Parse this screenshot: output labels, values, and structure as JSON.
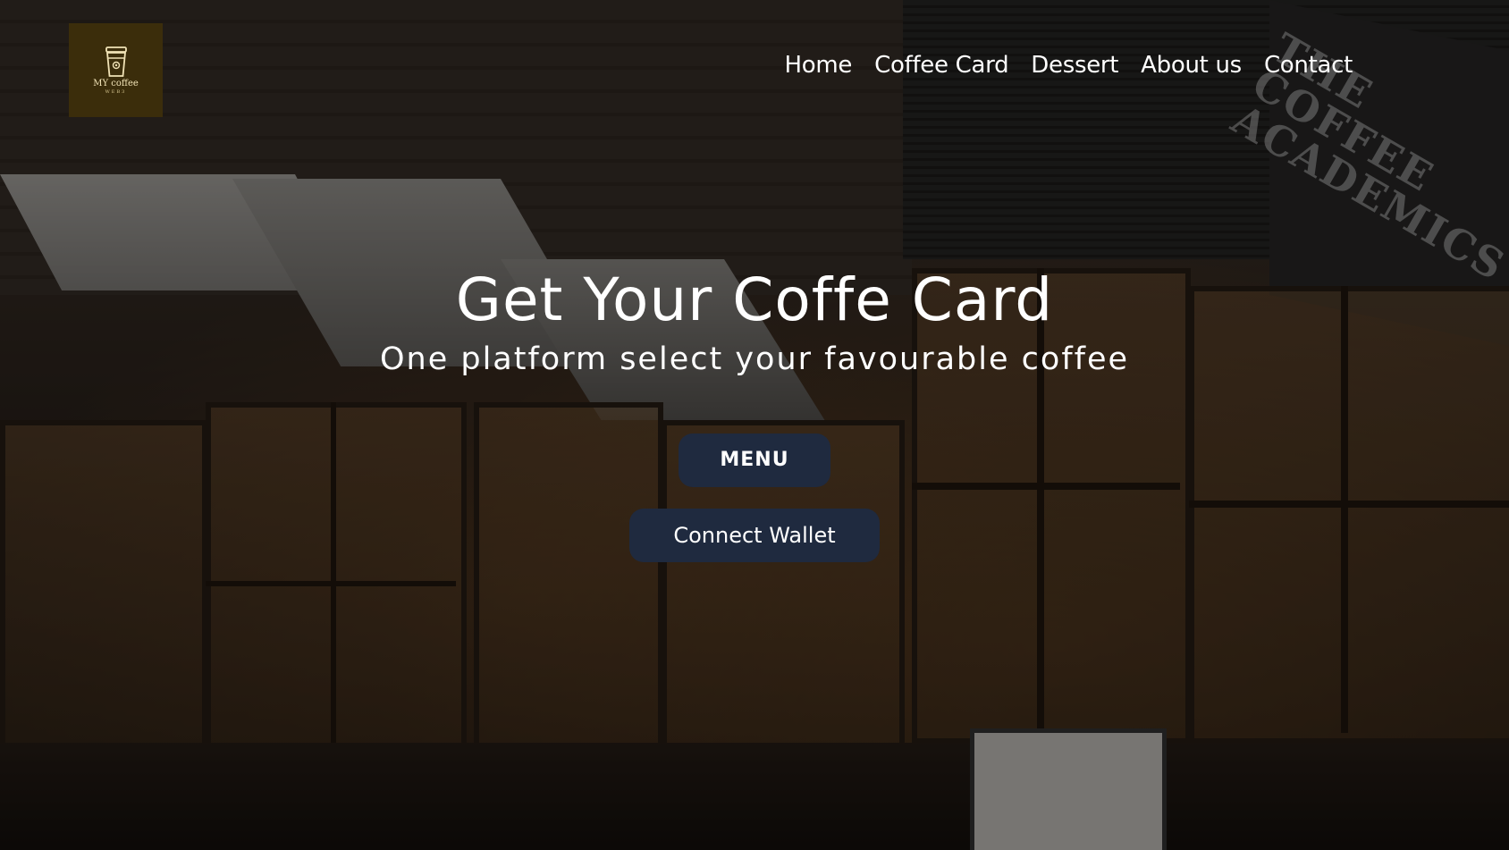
{
  "brand": {
    "logo_name": "MY coffee",
    "logo_subtitle": "WEB3",
    "logo_bg_color": "#3b2d0b",
    "logo_icon": "coffee-cup-icon"
  },
  "nav": {
    "items": [
      "Home",
      "Coffee Card",
      "Dessert",
      "About us",
      "Contact"
    ]
  },
  "hero": {
    "title": "Get Your Coffe Card",
    "subtitle": "One platform select your favourable coffee",
    "menu_button": "MENU",
    "wallet_button": "Connect Wallet",
    "button_color": "#1f2a3f",
    "background_image": "coffee-shop-storefront"
  },
  "background": {
    "storefront_sign": "THE COFFEE ACADEMICS"
  }
}
